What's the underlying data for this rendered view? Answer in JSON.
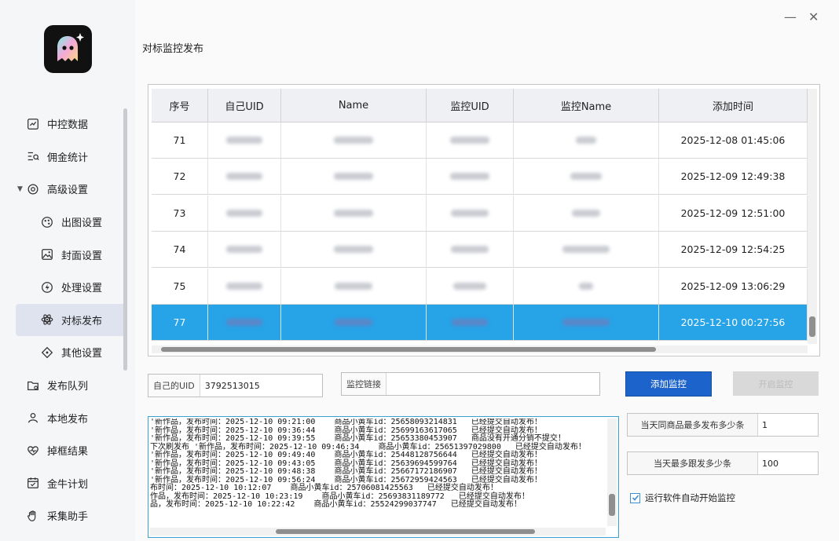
{
  "sidebar": {
    "items": [
      {
        "label": "中控数据",
        "icon": "chart-icon",
        "sub": false,
        "active": false
      },
      {
        "label": "佣金统计",
        "icon": "list-search-icon",
        "sub": false,
        "active": false
      },
      {
        "label": "高级设置",
        "icon": "gear-icon",
        "sub": false,
        "active": false,
        "expanded": true
      },
      {
        "label": "出图设置",
        "icon": "palette-icon",
        "sub": true,
        "active": false
      },
      {
        "label": "封面设置",
        "icon": "image-icon",
        "sub": true,
        "active": false
      },
      {
        "label": "处理设置",
        "icon": "lightning-icon",
        "sub": true,
        "active": false
      },
      {
        "label": "对标发布",
        "icon": "atom-icon",
        "sub": true,
        "active": true
      },
      {
        "label": "其他设置",
        "icon": "diamond-icon",
        "sub": true,
        "active": false
      },
      {
        "label": "发布队列",
        "icon": "folder-icon",
        "sub": false,
        "active": false
      },
      {
        "label": "本地发布",
        "icon": "user-upload-icon",
        "sub": false,
        "active": false
      },
      {
        "label": "掉框结果",
        "icon": "heart-pulse-icon",
        "sub": false,
        "active": false
      },
      {
        "label": "金牛计划",
        "icon": "calendar-icon",
        "sub": false,
        "active": false
      },
      {
        "label": "采集助手",
        "icon": "hand-icon",
        "sub": false,
        "active": false
      }
    ]
  },
  "window": {
    "minimize": "—",
    "close": "✕"
  },
  "page": {
    "title": "对标监控发布"
  },
  "table": {
    "headers": [
      "序号",
      "自己UID",
      "Name",
      "监控UID",
      "监控Name",
      "添加时间"
    ],
    "rows": [
      {
        "id": "71",
        "time": "2025-12-08 01:45:06"
      },
      {
        "id": "72",
        "time": "2025-12-09 12:49:38"
      },
      {
        "id": "73",
        "time": "2025-12-09 12:51:00"
      },
      {
        "id": "74",
        "time": "2025-12-09 12:54:25"
      },
      {
        "id": "75",
        "time": "2025-12-09 13:06:29"
      },
      {
        "id": "77",
        "time": "2025-12-10 00:27:56",
        "selected": true
      }
    ]
  },
  "form": {
    "own_uid_label": "自己的UID",
    "own_uid_value": "3792513015",
    "monitor_link_label": "监控链接",
    "monitor_link_value": "",
    "add_button": "添加监控",
    "start_button": "开启监控"
  },
  "log": {
    "lines": [
      "'新作品，发布时间：2025-12-10 09:21:00    商品小黄车id：25658093214831   已经提交自动发布！",
      "'新作品，发布时间：2025-12-10 09:36:44    商品小黄车id：25699163617065   已经提交自动发布！",
      "'新作品，发布时间：2025-12-10 09:39:55    商品小黄车id：25653380453907   商品没有开通分销不提交！",
      "下次刷发布 '新作品，发布时间：2025-12-10 09:46:34    商品小黄车id：25651397029800   已经提交自动发布！",
      "'新作品，发布时间：2025-12-10 09:49:40    商品小黄车id：25448128756644   已经提交自动发布！",
      "'新作品，发布时间：2025-12-10 09:43:05    商品小黄车id：25639694599764   已经提交自动发布！",
      "'新作品，发布时间：2025-12-10 09:48:38    商品小黄车id：25667172186907   已经提交自动发布！",
      "'新作品，发布时间：2025-12-10 09:56:24    商品小黄车id：25672959424563   已经提交自动发布！",
      "布时间：2025-12-10 10:12:07    商品小黄车id：25706081425563   已经提交自动发布！",
      "作品，发布时间：2025-12-10 10:23:19    商品小黄车id：25693831189772   已经提交自动发布！",
      "品，发布时间：2025-12-10 10:22:42    商品小黄车id：25524299037747   已经提交自动发布！"
    ]
  },
  "settings": {
    "max_same_product_label": "当天同商品最多发布多少条",
    "max_same_product_value": "1",
    "max_daily_label": "当天最多跟发多少条",
    "max_daily_value": "100",
    "autostart_label": "运行软件自动开始监控",
    "autostart_checked": true
  },
  "colors": {
    "accent": "#1d63cc",
    "selected_row": "#27a3e8",
    "log_border": "#3aa1d8"
  }
}
